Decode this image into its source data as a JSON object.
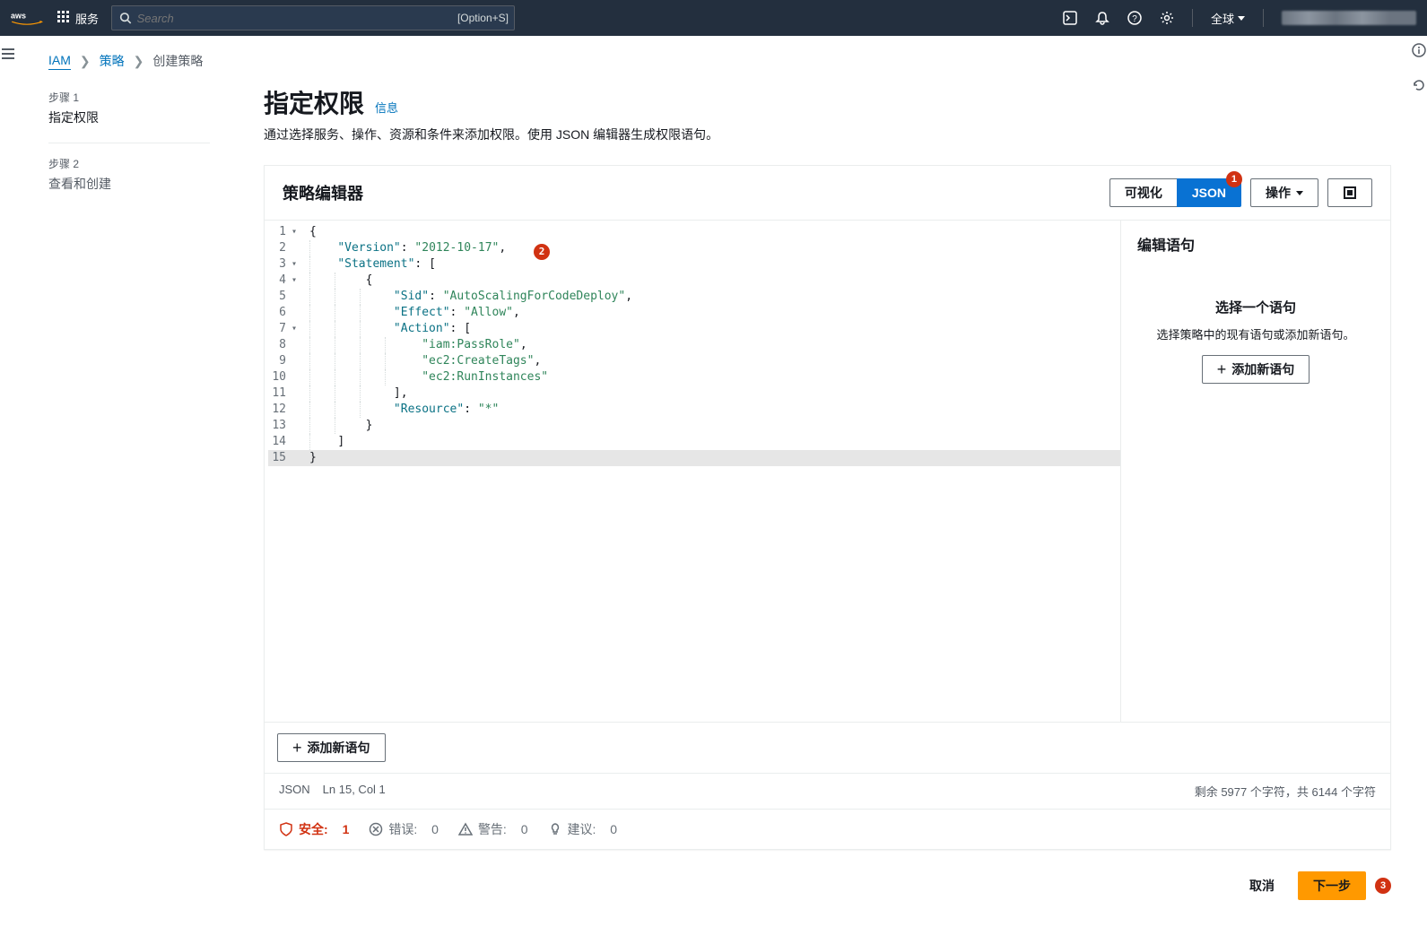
{
  "nav": {
    "services_label": "服务",
    "search_placeholder": "Search",
    "search_shortcut": "[Option+S]",
    "region_label": "全球"
  },
  "breadcrumb": {
    "iam": "IAM",
    "policies": "策略",
    "create": "创建策略"
  },
  "steps": [
    {
      "num": "步骤 1",
      "title": "指定权限"
    },
    {
      "num": "步骤 2",
      "title": "查看和创建"
    }
  ],
  "page": {
    "title": "指定权限",
    "info": "信息",
    "description": "通过选择服务、操作、资源和条件来添加权限。使用 JSON 编辑器生成权限语句。"
  },
  "editor": {
    "panel_title": "策略编辑器",
    "toggle_visual": "可视化",
    "toggle_json": "JSON",
    "actions_label": "操作",
    "callouts": {
      "c1": "1",
      "c2": "2",
      "c3": "3"
    },
    "code_lines": [
      {
        "n": "1",
        "fold": true,
        "raw": "{"
      },
      {
        "n": "2",
        "raw": "    \"Version\": \"2012-10-17\","
      },
      {
        "n": "3",
        "fold": true,
        "raw": "    \"Statement\": ["
      },
      {
        "n": "4",
        "fold": true,
        "raw": "        {"
      },
      {
        "n": "5",
        "raw": "            \"Sid\": \"AutoScalingForCodeDeploy\","
      },
      {
        "n": "6",
        "raw": "            \"Effect\": \"Allow\","
      },
      {
        "n": "7",
        "fold": true,
        "raw": "            \"Action\": ["
      },
      {
        "n": "8",
        "raw": "                \"iam:PassRole\","
      },
      {
        "n": "9",
        "raw": "                \"ec2:CreateTags\","
      },
      {
        "n": "10",
        "raw": "                \"ec2:RunInstances\""
      },
      {
        "n": "11",
        "raw": "            ],"
      },
      {
        "n": "12",
        "raw": "            \"Resource\": \"*\""
      },
      {
        "n": "13",
        "raw": "        }"
      },
      {
        "n": "14",
        "raw": "    ]"
      },
      {
        "n": "15",
        "hl": true,
        "raw": "}"
      }
    ],
    "add_statement_btn": "添加新语句",
    "side": {
      "title": "编辑语句",
      "empty_title": "选择一个语句",
      "empty_desc": "选择策略中的现有语句或添加新语句。",
      "add_btn": "添加新语句"
    },
    "status": {
      "lang": "JSON",
      "pos": "Ln 15, Col 1",
      "chars": "剩余 5977 个字符，共 6144 个字符"
    },
    "issues": {
      "security_label": "安全:",
      "security_count": "1",
      "errors_label": "错误:",
      "errors_count": "0",
      "warnings_label": "警告:",
      "warnings_count": "0",
      "suggestions_label": "建议:",
      "suggestions_count": "0"
    }
  },
  "footer": {
    "cancel": "取消",
    "next": "下一步"
  }
}
